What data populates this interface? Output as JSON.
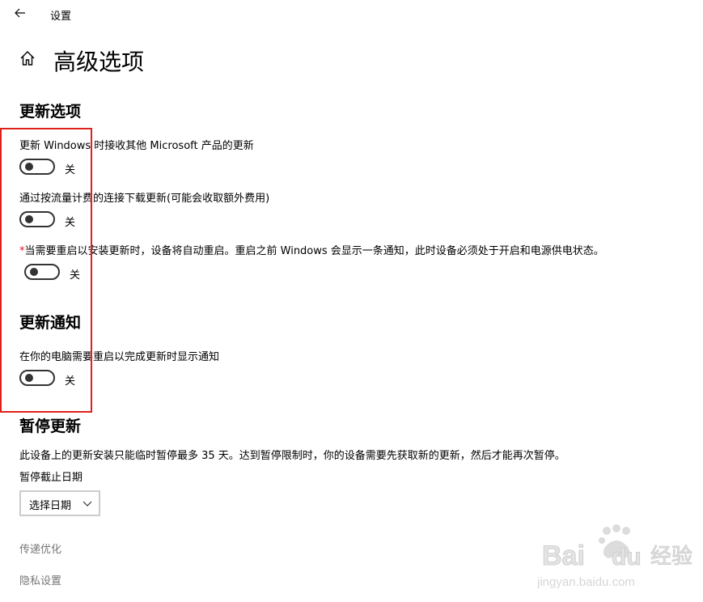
{
  "window": {
    "title": "设置"
  },
  "page": {
    "title": "高级选项"
  },
  "sections": {
    "update_options": {
      "title": "更新选项",
      "option1": {
        "label": "更新 Windows 时接收其他 Microsoft 产品的更新",
        "state": "关"
      },
      "option2": {
        "label": "通过按流量计费的连接下载更新(可能会收取额外费用)",
        "state": "关"
      },
      "option3": {
        "required_mark": "*",
        "label": "当需要重启以安装更新时，设备将自动重启。重启之前 Windows 会显示一条通知，此时设备必须处于开启和电源供电状态。",
        "state": "关"
      }
    },
    "update_notifications": {
      "title": "更新通知",
      "option1": {
        "label": "在你的电脑需要重启以完成更新时显示通知",
        "state": "关"
      }
    },
    "pause_updates": {
      "title": "暂停更新",
      "description": "此设备上的更新安装只能临时暂停最多 35 天。达到暂停限制时，你的设备需要先获取新的更新，然后才能再次暂停。",
      "date_label": "暂停截止日期",
      "select_value": "选择日期"
    }
  },
  "links": {
    "delivery_optimization": "传递优化",
    "privacy_settings": "隐私设置"
  },
  "watermark": {
    "brand": "Baidu经验",
    "url": "jingyan.baidu.com"
  },
  "colors": {
    "highlight": "#e0201b",
    "required": "#e81123",
    "link": "#767676"
  }
}
